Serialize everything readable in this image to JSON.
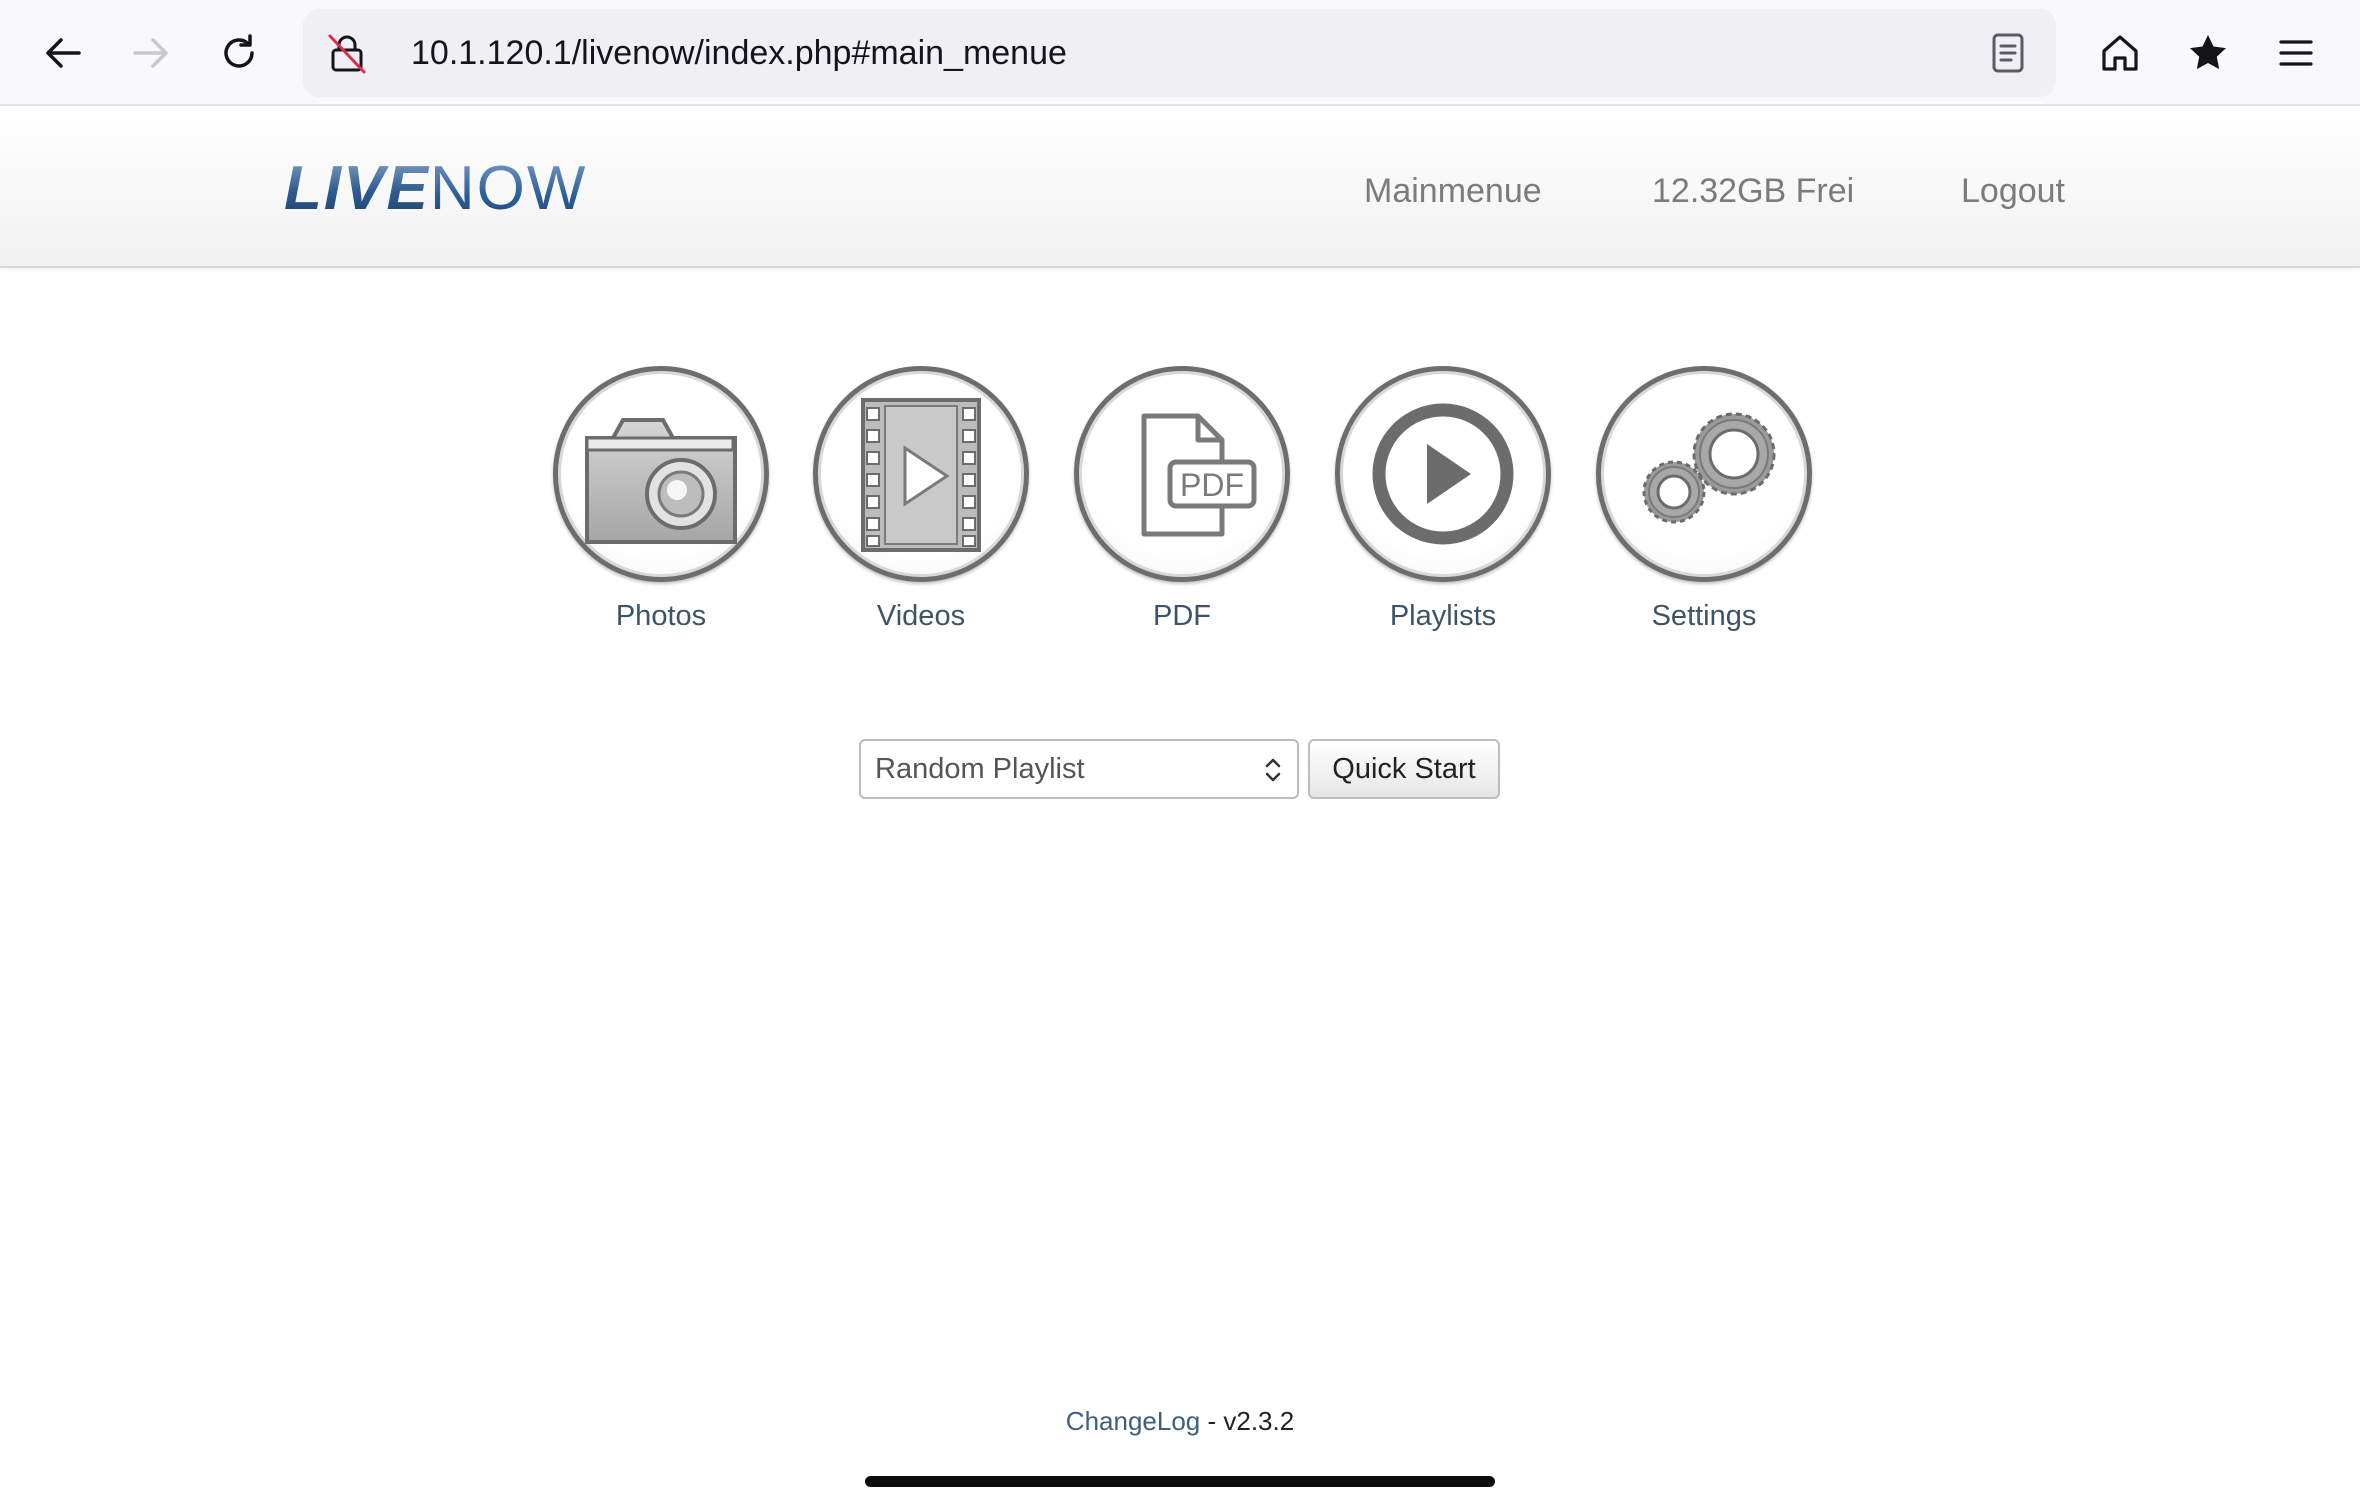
{
  "browser": {
    "url": "10.1.120.1/livenow/index.php#main_menue",
    "icons": [
      "back-icon",
      "forward-icon",
      "reload-icon",
      "insecure-lock-icon",
      "reader-view-icon",
      "home-icon",
      "bookmark-star-icon",
      "menu-icon"
    ]
  },
  "header": {
    "logo_part1": "LIVE",
    "logo_part2": "NOW",
    "nav": {
      "mainmenue": "Mainmenue",
      "storage": "12.32GB Frei",
      "logout": "Logout"
    }
  },
  "tiles": [
    {
      "label": "Photos",
      "icon": "camera-icon"
    },
    {
      "label": "Videos",
      "icon": "film-play-icon"
    },
    {
      "label": "PDF",
      "icon": "pdf-document-icon"
    },
    {
      "label": "Playlists",
      "icon": "play-circle-icon"
    },
    {
      "label": "Settings",
      "icon": "gears-icon"
    }
  ],
  "quickstart": {
    "selected_playlist": "Random Playlist",
    "button_label": "Quick Start"
  },
  "footer": {
    "changelog": "ChangeLog",
    "separator": " - ",
    "version": "v2.3.2"
  },
  "colors": {
    "logo_blue": "#2f5a8e",
    "nav_text": "#7b7b7b",
    "tile_label": "#3e5466",
    "link": "#3e5f80"
  }
}
